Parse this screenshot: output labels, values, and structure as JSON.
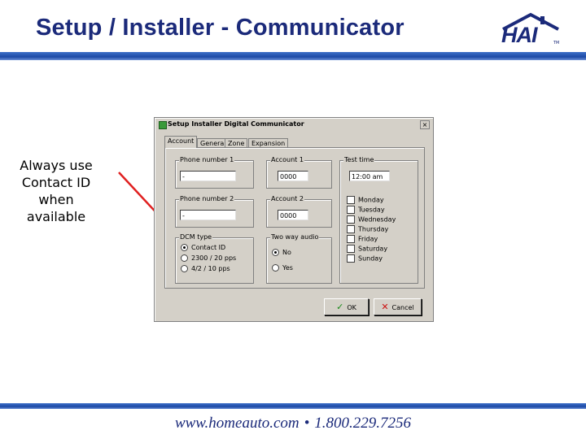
{
  "slide": {
    "title": "Setup / Installer - Communicator",
    "note": [
      "Always use",
      "Contact ID",
      "when",
      "available"
    ],
    "footer_url": "www.homeauto.com",
    "footer_sep": "•",
    "footer_phone": "1.800.229.7256"
  },
  "logo": {
    "text": "HAI",
    "tm": "TM"
  },
  "window": {
    "title": "Setup Installer Digital Communicator",
    "close": "×",
    "tabs": [
      "Account",
      "General",
      "Zone",
      "Expansion"
    ],
    "phone1": {
      "label": "Phone number 1",
      "value": "-"
    },
    "phone2": {
      "label": "Phone number 2",
      "value": "-"
    },
    "account1": {
      "label": "Account 1",
      "value": "0000"
    },
    "account2": {
      "label": "Account 2",
      "value": "0000"
    },
    "test_time": {
      "label": "Test time",
      "value": "12:00 am"
    },
    "days": [
      "Monday",
      "Tuesday",
      "Wednesday",
      "Thursday",
      "Friday",
      "Saturday",
      "Sunday"
    ],
    "dcm_type": {
      "label": "DCM type",
      "options": [
        "Contact ID",
        "2300 / 20 pps",
        "4/2 / 10 pps"
      ],
      "selected": 0
    },
    "two_way_audio": {
      "label": "Two way audio",
      "options": [
        "No",
        "Yes"
      ],
      "selected": 0
    },
    "ok_label": "OK",
    "cancel_label": "Cancel"
  },
  "colors": {
    "title": "#1b2a7a",
    "arrow": "#e02020",
    "rule": "#1d4aa6"
  }
}
